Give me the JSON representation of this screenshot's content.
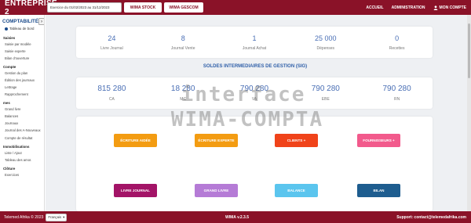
{
  "topbar": {
    "brand": "ENTREPRISE 2",
    "exercise": "Exercice du 01/02/2023 au 31/12/2023",
    "stock_label": "WIMA STOCK",
    "gescom_label": "WIMA GESCOM",
    "links": {
      "home": "ACCUEIL",
      "admin": "ADMINISTRATION",
      "account": "MON COMPTE"
    }
  },
  "sidebar": {
    "title": "COMPTABILITÉ",
    "dashboard": "Tableau de bord",
    "sections": [
      {
        "label": "Saisies",
        "items": [
          "Saisie par modèle",
          "Saisie experte",
          "Bilan d'ouverture"
        ]
      },
      {
        "label": "Compte",
        "items": [
          "Gestion du plan",
          "Édition des journaux",
          "Lettrage",
          "Rapprochement"
        ]
      },
      {
        "label": "mes",
        "items": [
          "Grand livre",
          "Balances",
          "Journaux",
          "Journal des A-Nouveaux",
          "Compte de résultat"
        ]
      },
      {
        "label": "Immobilisations",
        "items": [
          "Liste / Ajout",
          "Tableau des amor."
        ]
      },
      {
        "label": "Clôture",
        "items": [
          "Exercices"
        ]
      }
    ]
  },
  "stats": [
    {
      "value": "24",
      "label": "Livre Journal"
    },
    {
      "value": "8",
      "label": "Journal Vente"
    },
    {
      "value": "1",
      "label": "Journal Achat"
    },
    {
      "value": "25 000",
      "label": "Dépenses"
    },
    {
      "value": "0",
      "label": "Recettes"
    }
  ],
  "sig": {
    "title": "SOLDES INTERMEDIAIRES DE GESTION (SIG)",
    "items": [
      {
        "value": "815 280",
        "label": "CA"
      },
      {
        "value": "18 280",
        "label": "MC"
      },
      {
        "value": "790 280",
        "label": "VA"
      },
      {
        "value": "790 280",
        "label": "EBE"
      },
      {
        "value": "790 280",
        "label": "RN"
      }
    ]
  },
  "actions": {
    "ecriture_aidee": "ÉCRITURE AIDÉE",
    "ecriture_expert": "ÉCRITURE EXPERTE",
    "clients": "CLIENTS +",
    "fournisseurs": "FOURNISSEURS +",
    "livre_journal": "LIVRE JOURNAL",
    "grand_livre": "GRAND LIVRE",
    "balance": "BALANCE",
    "bilan": "BILAN"
  },
  "watermark": {
    "line1": "interface",
    "line2": "WIMA-COMPTA"
  },
  "footer": {
    "copyright": "Telemed Afrika © 2023",
    "language": "Français",
    "version": "WIMA v.2.3.5",
    "support": "Support: contact@telemedafrika.com"
  },
  "colors": {
    "brand": "#8a1228",
    "accent": "#4a6fb5"
  }
}
